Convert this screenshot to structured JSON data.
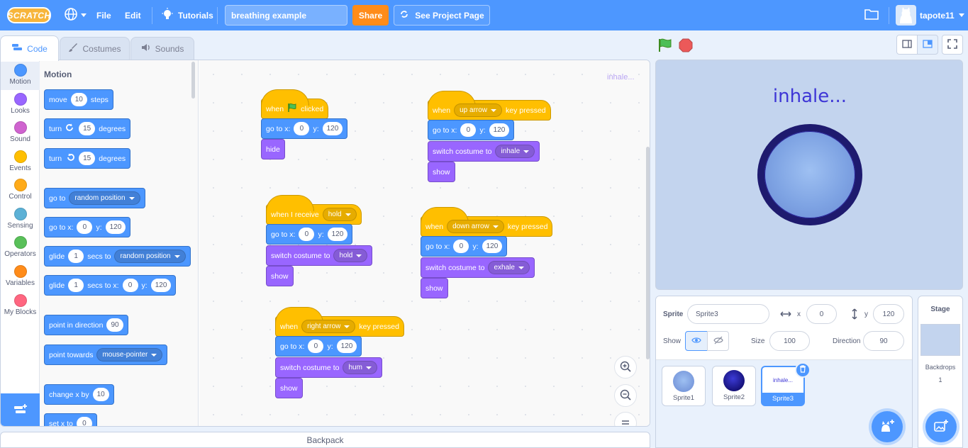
{
  "menubar": {
    "logo": "SCRATCH",
    "file": "File",
    "edit": "Edit",
    "tutorials": "Tutorials",
    "project_title": "breathing example",
    "share": "Share",
    "see_project_page": "See Project Page",
    "username": "tapote11"
  },
  "tabs": {
    "code": "Code",
    "costumes": "Costumes",
    "sounds": "Sounds"
  },
  "categories": [
    {
      "label": "Motion",
      "color": "#4c97ff"
    },
    {
      "label": "Looks",
      "color": "#9966ff"
    },
    {
      "label": "Sound",
      "color": "#cf63cf"
    },
    {
      "label": "Events",
      "color": "#ffbf00"
    },
    {
      "label": "Control",
      "color": "#ffab19"
    },
    {
      "label": "Sensing",
      "color": "#5cb1d6"
    },
    {
      "label": "Operators",
      "color": "#59c059"
    },
    {
      "label": "Variables",
      "color": "#ff8c1a"
    },
    {
      "label": "My Blocks",
      "color": "#ff6680"
    }
  ],
  "palette": {
    "title": "Motion",
    "move": {
      "a": "move",
      "v": "10",
      "b": "steps"
    },
    "turn_right": {
      "a": "turn",
      "v": "15",
      "b": "degrees"
    },
    "turn_left": {
      "a": "turn",
      "v": "15",
      "b": "degrees"
    },
    "goto": {
      "a": "go to",
      "dd": "random position"
    },
    "gotoxy": {
      "a": "go to x:",
      "x": "0",
      "b": "y:",
      "y": "120"
    },
    "glide": {
      "a": "glide",
      "v": "1",
      "b": "secs to",
      "dd": "random position"
    },
    "glidexy": {
      "a": "glide",
      "v": "1",
      "b": "secs to x:",
      "x": "0",
      "c": "y:",
      "y": "120"
    },
    "point_dir": {
      "a": "point in direction",
      "v": "90"
    },
    "point_towards": {
      "a": "point towards",
      "dd": "mouse-pointer"
    },
    "change_x": {
      "a": "change x by",
      "v": "10"
    },
    "set_x": {
      "a": "set x to",
      "v": "0"
    }
  },
  "scripts": {
    "ghost_label": "inhale...",
    "s1": {
      "when": "when",
      "clicked": "clicked",
      "goto": "go to x:",
      "x": "0",
      "ylab": "y:",
      "y": "120",
      "hide": "hide"
    },
    "s2": {
      "when": "when",
      "key": "up arrow",
      "pressed": "key pressed",
      "goto": "go to x:",
      "x": "0",
      "ylab": "y:",
      "y": "120",
      "switch": "switch costume to",
      "costume": "inhale",
      "show": "show"
    },
    "s3": {
      "when": "when I receive",
      "msg": "hold",
      "goto": "go to x:",
      "x": "0",
      "ylab": "y:",
      "y": "120",
      "switch": "switch costume to",
      "costume": "hold",
      "show": "show"
    },
    "s4": {
      "when": "when",
      "key": "down arrow",
      "pressed": "key pressed",
      "goto": "go to x:",
      "x": "0",
      "ylab": "y:",
      "y": "120",
      "switch": "switch costume to",
      "costume": "exhale",
      "show": "show"
    },
    "s5": {
      "when": "when",
      "key": "right arrow",
      "pressed": "key pressed",
      "goto": "go to x:",
      "x": "0",
      "ylab": "y:",
      "y": "120",
      "switch": "switch costume to",
      "costume": "hum",
      "show": "show"
    }
  },
  "backpack": "Backpack",
  "stage": {
    "text": "inhale..."
  },
  "sprite_info": {
    "sprite_label": "Sprite",
    "sprite_name": "Sprite3",
    "x_label": "x",
    "x": "0",
    "y_label": "y",
    "y": "120",
    "show_label": "Show",
    "size_label": "Size",
    "size": "100",
    "direction_label": "Direction",
    "direction": "90"
  },
  "sprites": [
    {
      "name": "Sprite1"
    },
    {
      "name": "Sprite2"
    },
    {
      "name": "Sprite3",
      "thumb_text": "inhale..."
    }
  ],
  "stage_pane": {
    "title": "Stage",
    "backdrops_label": "Backdrops",
    "backdrops_count": "1"
  }
}
